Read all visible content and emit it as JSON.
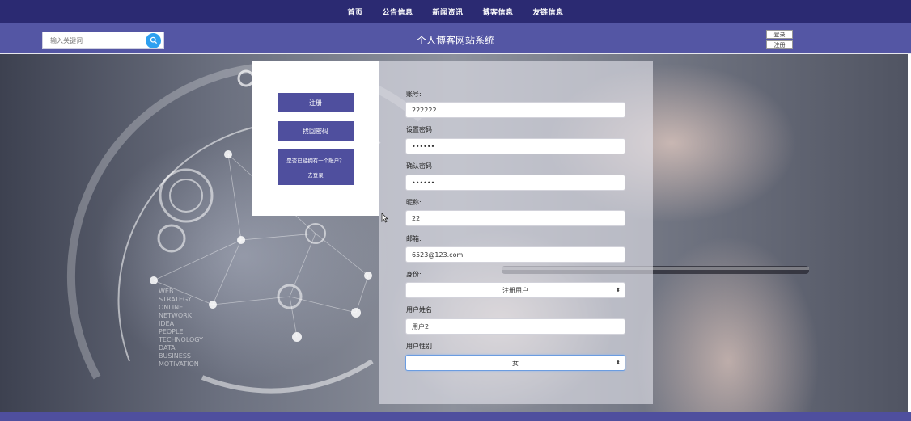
{
  "nav": {
    "items": [
      "首页",
      "公告信息",
      "新闻资讯",
      "博客信息",
      "友链信息"
    ]
  },
  "header": {
    "search_placeholder": "输入关键词",
    "title": "个人博客网站系统",
    "login_label": "登录",
    "register_label": "注册"
  },
  "sidepanel": {
    "register_label": "注册",
    "forgot_label": "找回密码",
    "has_account_line1": "是否已经拥有一个账户？",
    "has_account_line2": "去登录"
  },
  "form": {
    "account_label": "账号:",
    "account_value": "222222",
    "password_label": "设置密码",
    "password_value": "••••••",
    "confirm_label": "确认密码",
    "confirm_value": "••••••",
    "nickname_label": "昵称:",
    "nickname_value": "22",
    "email_label": "邮箱:",
    "email_value": "6523@123.com",
    "role_label": "身份:",
    "role_value": "注册用户",
    "name_label": "用户姓名",
    "name_value": "用户2",
    "gender_label": "用户性别",
    "gender_value": "女"
  },
  "colors": {
    "nav_bg": "#2b2a72",
    "header_bg": "#5456a4",
    "button_bg": "#4f4f9e",
    "search_button": "#2ea0f0"
  }
}
